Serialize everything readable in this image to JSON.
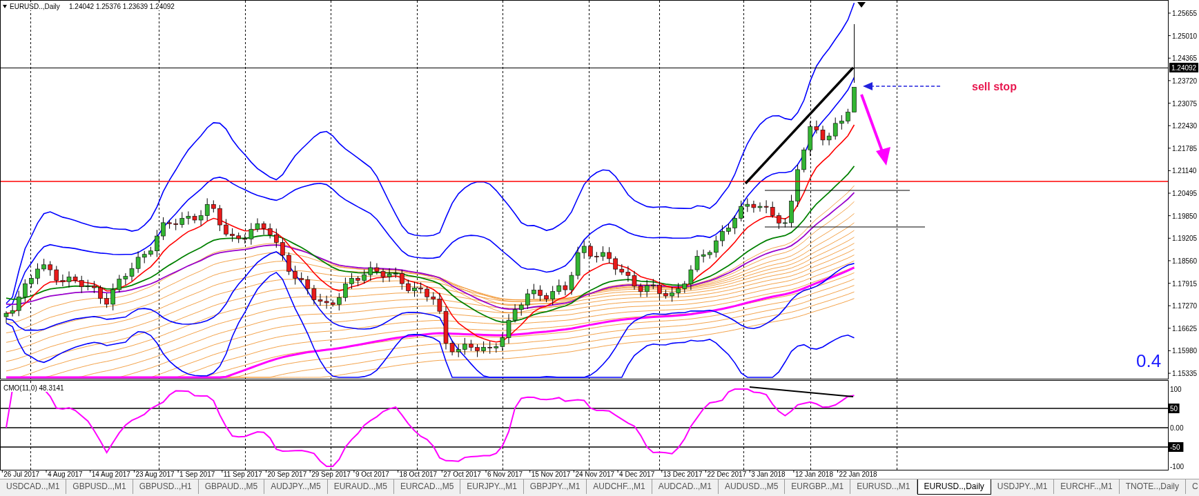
{
  "chart": {
    "header": {
      "symbol": "EURUSD..,Daily",
      "ohlc": "1.24042 1.25376 1.23639 1.24092"
    },
    "price_axis": [
      "1.25655",
      "1.25010",
      "1.24365",
      "1.23720",
      "1.23075",
      "1.22430",
      "1.21785",
      "1.21140",
      "1.20495",
      "1.19850",
      "1.19205",
      "1.18560",
      "1.17915",
      "1.17270",
      "1.16625",
      "1.15980",
      "1.15335"
    ],
    "current_price": "1.24092",
    "annotation": "sell stop",
    "corner_label": "0.4"
  },
  "indicator": {
    "header": "CMO(11,0) 48.3141",
    "axis": [
      {
        "label": "100",
        "highlighted": false
      },
      {
        "label": "50",
        "highlighted": true
      },
      {
        "label": "0.00",
        "highlighted": false
      },
      {
        "label": "-50",
        "highlighted": true
      },
      {
        "label": "-100",
        "highlighted": false
      }
    ]
  },
  "time_axis": [
    "26 Jul 2017",
    "4 Aug 2017",
    "14 Aug 2017",
    "23 Aug 2017",
    "1 Sep 2017",
    "11 Sep 2017",
    "20 Sep 2017",
    "29 Sep 2017",
    "9 Oct 2017",
    "18 Oct 2017",
    "27 Oct 2017",
    "6 Nov 2017",
    "15 Nov 2017",
    "24 Nov 2017",
    "4 Dec 2017",
    "13 Dec 2017",
    "22 Dec 2017",
    "3 Jan 2018",
    "12 Jan 2018",
    "22 Jan 2018"
  ],
  "tabs": [
    {
      "label": "USDCAD..,M1",
      "selected": false
    },
    {
      "label": "GBPUSD..,M1",
      "selected": false
    },
    {
      "label": "GBPUSD..,H1",
      "selected": false
    },
    {
      "label": "GBPAUD..,M5",
      "selected": false
    },
    {
      "label": "AUDJPY..,M5",
      "selected": false
    },
    {
      "label": "EURAUD..,M5",
      "selected": false
    },
    {
      "label": "EURCAD..,M5",
      "selected": false
    },
    {
      "label": "EURJPY..,M1",
      "selected": false
    },
    {
      "label": "GBPJPY..,M1",
      "selected": false
    },
    {
      "label": "AUDCHF..,M1",
      "selected": false
    },
    {
      "label": "AUDCAD..,M1",
      "selected": false
    },
    {
      "label": "AUDUSD..,M5",
      "selected": false
    },
    {
      "label": "EURGBP..,M1",
      "selected": false
    },
    {
      "label": "EURUSD..,M1",
      "selected": false
    },
    {
      "label": "EURUSD..,Daily",
      "selected": true
    },
    {
      "label": "USDJPY..,M1",
      "selected": false
    },
    {
      "label": "EURCHF..,M1",
      "selected": false
    },
    {
      "label": "TNOTE..,Daily",
      "selected": false
    },
    {
      "label": "C",
      "selected": false
    }
  ]
}
